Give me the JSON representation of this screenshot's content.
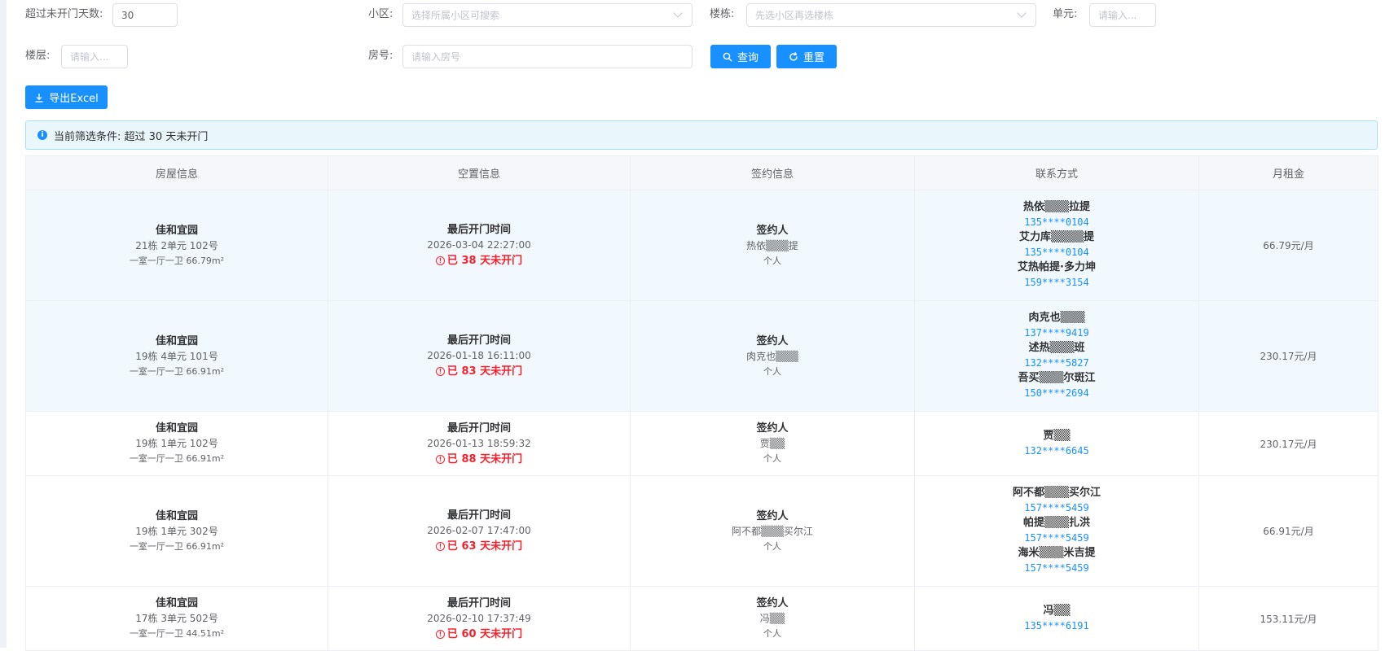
{
  "filters": {
    "days_label": "超过未开门天数:",
    "days_value": "30",
    "community_label": "小区:",
    "community_placeholder": "选择所属小区可搜索",
    "building_label": "楼栋:",
    "building_placeholder": "先选小区再选楼栋",
    "unit_label": "单元:",
    "unit_placeholder": "请输入...",
    "floor_label": "楼层:",
    "floor_placeholder": "请输入...",
    "room_label": "房号:",
    "room_placeholder": "请输入房号",
    "query_label": "查询",
    "reset_label": "重置"
  },
  "export_label": "导出Excel",
  "alert_text": "当前筛选条件: 超过 30 天未开门",
  "table": {
    "headers": [
      "房屋信息",
      "空置信息",
      "签约信息",
      "联系方式",
      "月租金"
    ],
    "rows": [
      {
        "community": "佳和宜园",
        "room": "21栋 2单元 102号",
        "spec": "一室一厅一卫 66.79m²",
        "vacancy_title": "最后开门时间",
        "last_open": "2026-03-04 22:27:00",
        "days_text": "已 38 天未开门",
        "sign_title": "签约人",
        "signer": "热依▒▒▒提",
        "sign_type": "个人",
        "contacts": [
          {
            "name": "热依▒▒▒拉提",
            "phone": "135****0104"
          },
          {
            "name": "艾力库▒▒▒▒提",
            "phone": "135****0104"
          },
          {
            "name": "艾热帕提·多力坤",
            "phone": "159****3154"
          }
        ],
        "rent": "66.79元/月"
      },
      {
        "community": "佳和宜园",
        "room": "19栋 4单元 101号",
        "spec": "一室一厅一卫 66.91m²",
        "vacancy_title": "最后开门时间",
        "last_open": "2026-01-18 16:11:00",
        "days_text": "已 83 天未开门",
        "sign_title": "签约人",
        "signer": "肉克也▒▒▒",
        "sign_type": "个人",
        "contacts": [
          {
            "name": "肉克也▒▒▒",
            "phone": "137****9419"
          },
          {
            "name": "述热▒▒▒班",
            "phone": "132****5827"
          },
          {
            "name": "吾买▒▒▒尔斑江",
            "phone": "150****2694"
          }
        ],
        "rent": "230.17元/月"
      },
      {
        "community": "佳和宜园",
        "room": "19栋 1单元 102号",
        "spec": "一室一厅一卫 66.91m²",
        "vacancy_title": "最后开门时间",
        "last_open": "2026-01-13 18:59:32",
        "days_text": "已 88 天未开门",
        "sign_title": "签约人",
        "signer": "贾▒▒",
        "sign_type": "个人",
        "contacts": [
          {
            "name": "贾▒▒",
            "phone": "132****6645"
          }
        ],
        "rent": "230.17元/月"
      },
      {
        "community": "佳和宜园",
        "room": "19栋 1单元 302号",
        "spec": "一室一厅一卫 66.91m²",
        "vacancy_title": "最后开门时间",
        "last_open": "2026-02-07 17:47:00",
        "days_text": "已 63 天未开门",
        "sign_title": "签约人",
        "signer": "阿不都▒▒▒买尔江",
        "sign_type": "个人",
        "contacts": [
          {
            "name": "阿不都▒▒▒买尔江",
            "phone": "157****5459"
          },
          {
            "name": "帕提▒▒▒扎洪",
            "phone": "157****5459"
          },
          {
            "name": "海米▒▒▒米吉提",
            "phone": "157****5459"
          }
        ],
        "rent": "66.91元/月"
      },
      {
        "community": "佳和宜园",
        "room": "17栋 3单元 502号",
        "spec": "一室一厅一卫 44.51m²",
        "vacancy_title": "最后开门时间",
        "last_open": "2026-02-10 17:37:49",
        "days_text": "已 60 天未开门",
        "sign_title": "签约人",
        "signer": "冯▒▒",
        "sign_type": "个人",
        "contacts": [
          {
            "name": "冯▒▒",
            "phone": "135****6191"
          }
        ],
        "rent": "153.11元/月"
      }
    ]
  }
}
